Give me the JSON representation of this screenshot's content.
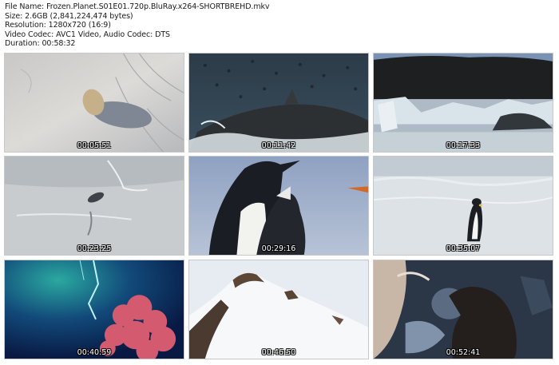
{
  "header": {
    "file_name": "File Name: Frozen.Planet.S01E01.720p.BluRay.x264-SHORTBREHD.mkv",
    "size": "Size: 2.6GB (2,841,224,474 bytes)",
    "resolution": "Resolution: 1280x720 (16:9)",
    "codec": "Video Codec: AVC1 Video, Audio Codec: DTS",
    "duration": "Duration: 00:58:32"
  },
  "thumbnails": [
    {
      "timestamp": "00:05:51"
    },
    {
      "timestamp": "00:11:42"
    },
    {
      "timestamp": "00:17:33"
    },
    {
      "timestamp": "00:23:25"
    },
    {
      "timestamp": "00:29:16"
    },
    {
      "timestamp": "00:35:07"
    },
    {
      "timestamp": "00:40:59"
    },
    {
      "timestamp": "00:46:50"
    },
    {
      "timestamp": "00:52:41"
    }
  ]
}
